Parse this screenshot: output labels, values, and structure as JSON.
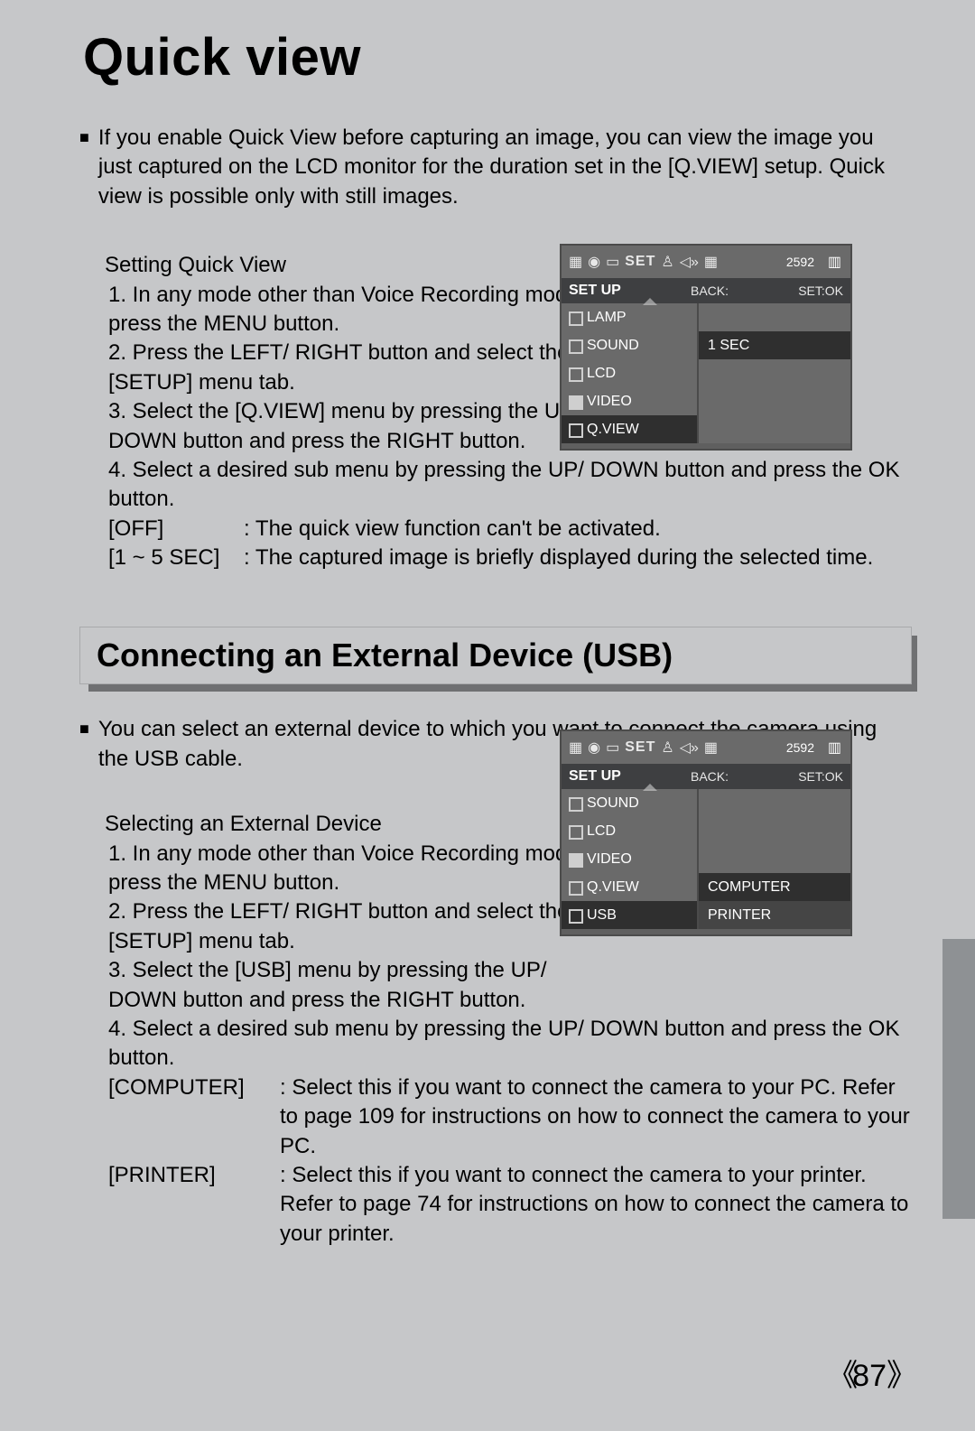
{
  "page_number": "87",
  "section1": {
    "title": "Quick view",
    "intro": "If you enable Quick View before capturing an image, you can view the image you just captured on the LCD monitor for the duration set in the [Q.VIEW] setup. Quick view is possible only with still images.",
    "subhead": "Setting Quick View",
    "steps": [
      "1. In any mode other than Voice Recording mode, press the MENU button.",
      "2. Press the LEFT/ RIGHT button and select the [SETUP] menu tab.",
      "3. Select the [Q.VIEW] menu by pressing the UP/ DOWN button and press the RIGHT button.",
      "4. Select a desired sub menu by pressing the UP/ DOWN button and press the OK button."
    ],
    "options": [
      {
        "key": "[OFF]",
        "desc": ": The quick view function can't be activated."
      },
      {
        "key": "[1 ~ 5 SEC]",
        "desc": ": The captured image is briefly displayed during the selected time."
      }
    ]
  },
  "section2": {
    "title": "Connecting an External Device (USB)",
    "intro": "You can select an external device to which you want to connect the camera using the USB cable.",
    "subhead": "Selecting an External Device",
    "steps": [
      "1. In any mode other than Voice Recording mode, press the MENU button.",
      "2. Press the LEFT/ RIGHT button and select the [SETUP] menu tab.",
      "3. Select the [USB] menu by pressing the UP/ DOWN button and press the RIGHT button.",
      "4. Select a desired sub menu by pressing the UP/ DOWN button and press the OK button."
    ],
    "options": [
      {
        "key": "[COMPUTER]",
        "desc": ": Select this if you want to connect the camera to your PC. Refer to page 109 for instructions on how to connect the camera to your PC."
      },
      {
        "key": "[PRINTER]",
        "desc": ": Select this if you want to connect the camera to your printer. Refer to page 74 for instructions on how to connect the camera to your printer."
      }
    ]
  },
  "lcd1": {
    "resolution": "2592",
    "set_tab": "SET",
    "header": {
      "title": "SET UP",
      "back": "BACK:",
      "ok": "SET:OK"
    },
    "items": [
      "LAMP",
      "SOUND",
      "LCD",
      "VIDEO",
      "Q.VIEW"
    ],
    "selected_index": 4,
    "right_value": "1 SEC",
    "right_value_row": 1
  },
  "lcd2": {
    "resolution": "2592",
    "set_tab": "SET",
    "header": {
      "title": "SET UP",
      "back": "BACK:",
      "ok": "SET:OK"
    },
    "items": [
      "SOUND",
      "LCD",
      "VIDEO",
      "Q.VIEW",
      "USB"
    ],
    "selected_index": 4,
    "right_values": [
      {
        "row": 3,
        "label": "COMPUTER",
        "sel": true
      },
      {
        "row": 4,
        "label": "PRINTER",
        "sel": false
      }
    ]
  }
}
